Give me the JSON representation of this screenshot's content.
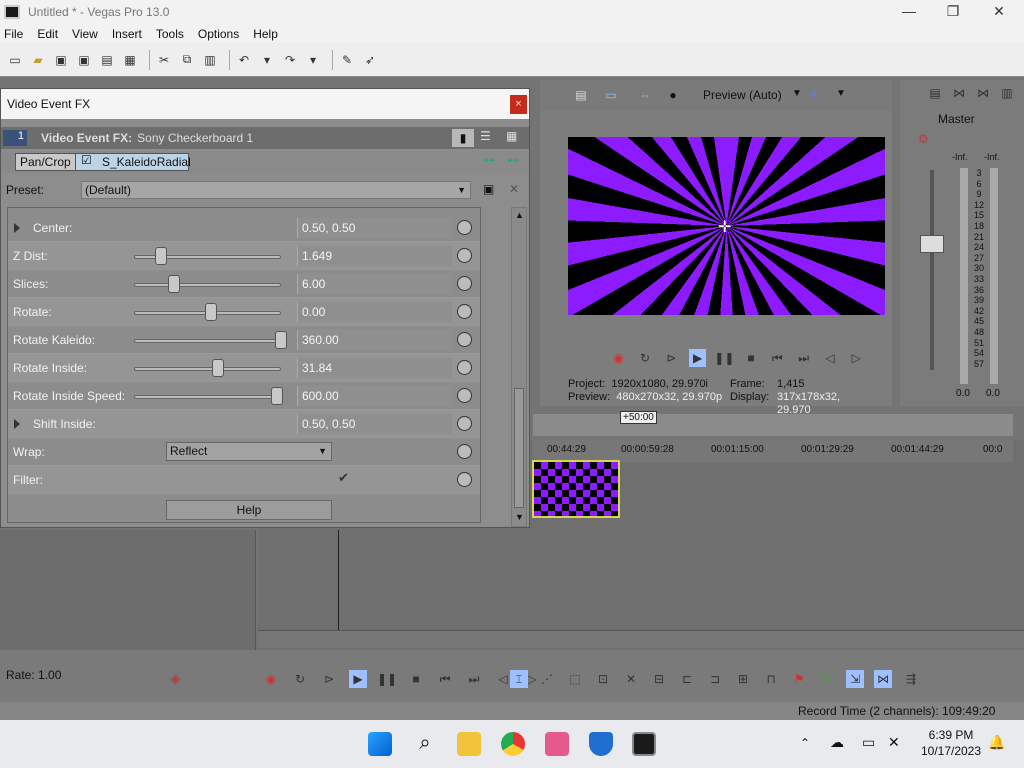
{
  "window": {
    "title": "Untitled * - Vegas Pro 13.0",
    "minimize": "—",
    "maximize": "❐",
    "close": "✕"
  },
  "menu": [
    "File",
    "Edit",
    "View",
    "Insert",
    "Tools",
    "Options",
    "Help"
  ],
  "dialog": {
    "title": "Video Event FX",
    "close": "×",
    "track_num": "1",
    "fx_label": "Video Event FX:",
    "fx_name": "Sony Checkerboard 1",
    "chain": [
      "Pan/Crop",
      "S_KaleidoRadial"
    ],
    "preset_label": "Preset:",
    "preset_value": "(Default)",
    "params": [
      {
        "label": "Center:",
        "value": "0.50, 0.50",
        "expandable": true
      },
      {
        "label": "Z Dist:",
        "value": "1.649",
        "slider": 0.15
      },
      {
        "label": "Slices:",
        "value": "6.00",
        "slider": 0.24
      },
      {
        "label": "Rotate:",
        "value": "0.00",
        "slider": 0.5
      },
      {
        "label": "Rotate Kaleido:",
        "value": "360.00",
        "slider": 1.0
      },
      {
        "label": "Rotate Inside:",
        "value": "31.84",
        "slider": 0.55
      },
      {
        "label": "Rotate Inside Speed:",
        "value": "600.00",
        "slider": 0.97
      },
      {
        "label": "Shift Inside:",
        "value": "0.50, 0.50",
        "expandable": true
      },
      {
        "label": "Wrap:",
        "value": "Reflect",
        "dropdown": true
      },
      {
        "label": "Filter:",
        "value": "✔",
        "checkbox": true
      }
    ],
    "help": "Help"
  },
  "preview": {
    "mode": "Preview (Auto)",
    "project_label": "Project:",
    "project": "1920x1080, 29.970i",
    "preview_label": "Preview:",
    "preview": "480x270x32, 29.970p",
    "frame_label": "Frame:",
    "frame": "1,415",
    "display_label": "Display:",
    "display": "317x178x32, 29.970"
  },
  "master": {
    "title": "Master",
    "inf_left": "-Inf.",
    "inf_right": "-Inf.",
    "scale": [
      "3",
      "6",
      "9",
      "12",
      "15",
      "18",
      "21",
      "24",
      "27",
      "30",
      "33",
      "36",
      "39",
      "42",
      "45",
      "48",
      "51",
      "54",
      "57"
    ],
    "out_left": "0.0",
    "out_right": "0.0"
  },
  "timeline": {
    "offset": "+50:00",
    "ticks": [
      "00:44:29",
      "00:00:59:28",
      "00:01:15:00",
      "00:01:29:29",
      "00:01:44:29",
      "00:0"
    ]
  },
  "rate": "Rate: 1.00",
  "status": "Record Time (2 channels): 109:49:20",
  "taskbar": {
    "time": "6:39 PM",
    "date": "10/17/2023"
  },
  "colors": {
    "accent": "#8d1bff",
    "close_red": "#c42b1c"
  }
}
